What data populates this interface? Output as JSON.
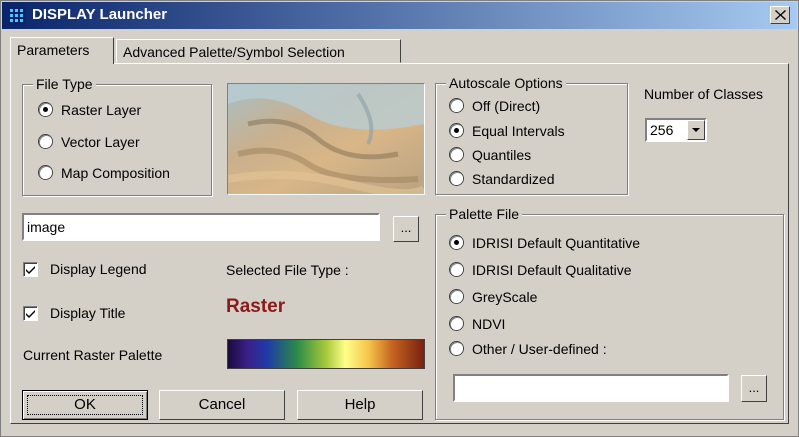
{
  "window": {
    "title": "DISPLAY Launcher",
    "close_icon": "close-icon"
  },
  "tabs": [
    {
      "label": "Parameters",
      "active": true
    },
    {
      "label": "Advanced Palette/Symbol Selection",
      "active": false
    }
  ],
  "file_type": {
    "label": "File Type",
    "options": [
      {
        "label": "Raster Layer",
        "checked": true
      },
      {
        "label": "Vector Layer",
        "checked": false
      },
      {
        "label": "Map Composition",
        "checked": false
      }
    ]
  },
  "autoscale": {
    "label": "Autoscale Options",
    "options": [
      {
        "label": "Off (Direct)",
        "checked": false
      },
      {
        "label": "Equal Intervals",
        "checked": true
      },
      {
        "label": "Quantiles",
        "checked": false
      },
      {
        "label": "Standardized",
        "checked": false
      }
    ]
  },
  "classes": {
    "label": "Number of  Classes",
    "value": "256"
  },
  "file_input": {
    "value": "image",
    "browse_label": "..."
  },
  "display_legend": {
    "label": "Display Legend",
    "checked": true
  },
  "display_title": {
    "label": "Display Title",
    "checked": true
  },
  "selected_type": {
    "label": "Selected File Type :",
    "value": "Raster",
    "color": "#8b1a1a"
  },
  "current_palette": {
    "label": "Current Raster Palette"
  },
  "palette_file": {
    "label": "Palette File",
    "options": [
      {
        "label": "IDRISI Default Quantitative",
        "checked": true
      },
      {
        "label": "IDRISI Default Qualitative",
        "checked": false
      },
      {
        "label": "GreyScale",
        "checked": false
      },
      {
        "label": "NDVI",
        "checked": false
      },
      {
        "label": "Other / User-defined :",
        "checked": false
      }
    ],
    "custom_value": "",
    "browse_label": "..."
  },
  "buttons": {
    "ok": "OK",
    "cancel": "Cancel",
    "help": "Help"
  }
}
